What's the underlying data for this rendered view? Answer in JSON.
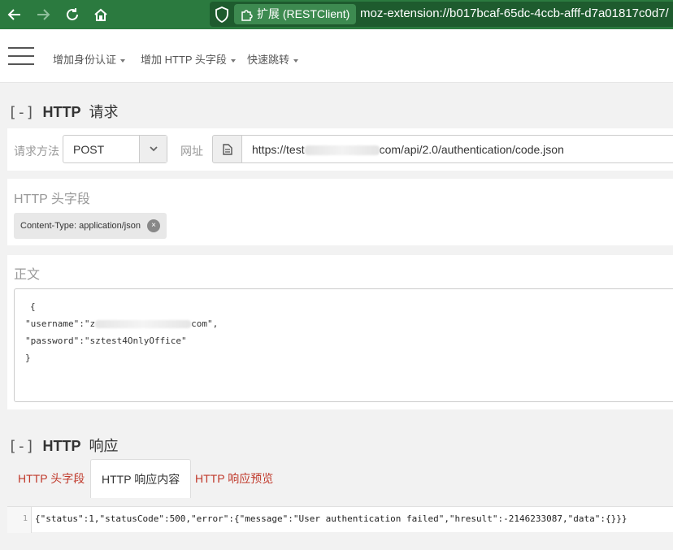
{
  "browser": {
    "extension_label": "扩展 (RESTClient)",
    "url": "moz-extension://b017bcaf-65dc-4ccb-afff-d7a01817c0d7/"
  },
  "toolbar": {
    "menu": [
      {
        "label": "增加身份认证"
      },
      {
        "label": "增加 HTTP 头字段"
      },
      {
        "label": "快速跳转"
      }
    ]
  },
  "request": {
    "toggle": "[-]",
    "title_bold": "HTTP",
    "title_rest": "请求",
    "method_label": "请求方法",
    "method_value": "POST",
    "url_label": "网址",
    "url_prefix": "https://test",
    "url_suffix": "com/api/2.0/authentication/code.json"
  },
  "headers": {
    "title": "HTTP 头字段",
    "tags": [
      {
        "text": "Content-Type: application/json",
        "remove": "×"
      }
    ]
  },
  "body": {
    "title": "正文",
    "lines": {
      "l1": "{",
      "l2_prefix": "\"username\":\"z",
      "l2_suffix": "com\",",
      "l3": "\"password\":\"sztest4OnlyOffice\"",
      "l4": "}"
    }
  },
  "response": {
    "toggle": "[-]",
    "title_bold": "HTTP",
    "title_rest": "响应",
    "tabs": [
      {
        "label": "HTTP 头字段"
      },
      {
        "label": "HTTP 响应内容"
      },
      {
        "label": "HTTP 响应预览"
      }
    ],
    "active_tab": "HTTP 响应内容",
    "line_number": "1",
    "content": "{\"status\":1,\"statusCode\":500,\"error\":{\"message\":\"User authentication failed\",\"hresult\":-2146233087,\"data\":{}}}"
  },
  "colors": {
    "browser_green": "#2b7a3f",
    "link_red": "#c0392b"
  }
}
